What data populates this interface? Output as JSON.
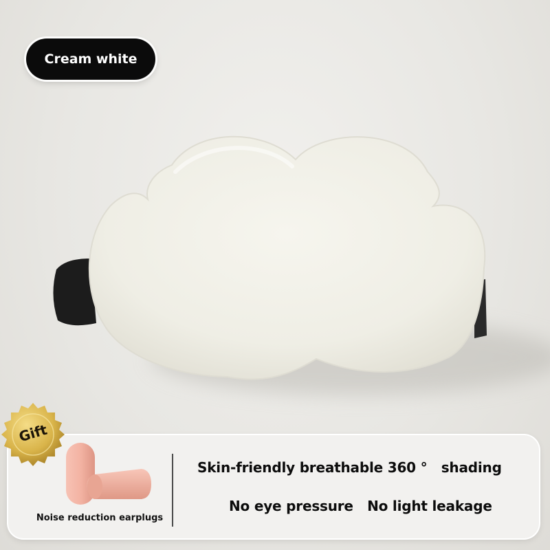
{
  "color_label": "Cream white",
  "product": {
    "name_icon": "cloud-eye-mask",
    "mask_color": "#f0efe7",
    "strap_color": "#1c1c1c"
  },
  "gift": {
    "badge_text": "Gift",
    "badge_color": "#d9b44a",
    "earplugs_icon": "earplugs",
    "earplugs_color": "#f3b3a3",
    "caption": "Noise reduction earplugs"
  },
  "features": {
    "line1": "Skin-friendly breathable 360 °   shading",
    "line2": "No eye pressure   No light leakage"
  }
}
